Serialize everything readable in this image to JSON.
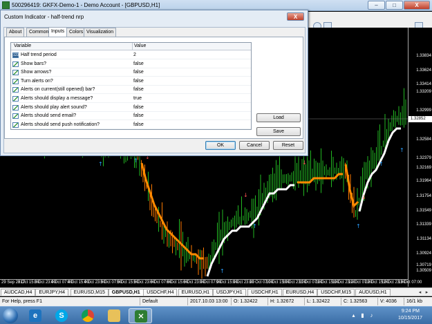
{
  "window": {
    "title": "500296419: GKFX-Demo-1 - Demo Account - [GBPUSD,H1]",
    "minimize": "–",
    "maximize": "□",
    "close": "X"
  },
  "dialog": {
    "title": "Custom Indicator - half-trend nrp",
    "close_label": "X",
    "tabs": [
      {
        "label": "About"
      },
      {
        "label": "Common"
      },
      {
        "label": "Inputs"
      },
      {
        "label": "Colors"
      },
      {
        "label": "Visualization"
      }
    ],
    "active_tab": "Inputs",
    "columns": {
      "variable": "Variable",
      "value": "Value"
    },
    "params": [
      {
        "name": "Half trend period",
        "value": "2",
        "kind": "param"
      },
      {
        "name": "Show bars?",
        "value": "false",
        "kind": "bool"
      },
      {
        "name": "Show arrows?",
        "value": "false",
        "kind": "bool"
      },
      {
        "name": "Turn alerts on?",
        "value": "false",
        "kind": "bool"
      },
      {
        "name": "Alerts on current(still opened) bar?",
        "value": "false",
        "kind": "bool"
      },
      {
        "name": "Alerts should display a message?",
        "value": "true",
        "kind": "bool"
      },
      {
        "name": "Alerts should play alert sound?",
        "value": "false",
        "kind": "bool"
      },
      {
        "name": "Alerts should send email?",
        "value": "false",
        "kind": "bool"
      },
      {
        "name": "Alerts should send push notification?",
        "value": "false",
        "kind": "bool"
      }
    ],
    "load_label": "Load",
    "save_label": "Save",
    "ok_label": "OK",
    "cancel_label": "Cancel",
    "reset_label": "Reset"
  },
  "chart": {
    "symbol": "GBPUSD,H1",
    "current_price": "1.32852",
    "price_labels": [
      "1.33834",
      "1.33624",
      "1.33414",
      "1.33209",
      "1.32999",
      "1.32584",
      "1.32379",
      "1.32169",
      "1.31964",
      "1.31754",
      "1.31549",
      "1.31339",
      "1.31134",
      "1.30924",
      "1.30719",
      "1.30509"
    ],
    "time_labels": [
      "29 Sep 2017",
      "3 Oct 15:00",
      "3 Oct 23:00",
      "4 Oct 07:00",
      "4 Oct 15:00",
      "4 Oct 23:00",
      "5 Oct 07:00",
      "5 Oct 15:00",
      "5 Oct 23:00",
      "6 Oct 07:00",
      "6 Oct 15:00",
      "6 Oct 23:00",
      "9 Oct 07:00",
      "9 Oct 15:00",
      "9 Oct 23:00",
      "10 Oct 07:00",
      "10 Oct 15:00",
      "10 Oct 23:00",
      "11 Oct 07:00",
      "11 Oct 15:00",
      "11 Oct 23:00",
      "12 Oct 07:00",
      "12 Oct 15:00",
      "12 Oct 23:00",
      "13 Oct 07:00"
    ]
  },
  "symbol_tabs": [
    "AUDCAD,H4",
    "EURJPY,H4",
    "EURUSD,M15",
    "GBPUSD,H1",
    "USDCHF,H4",
    "EURUSD,H1",
    "USDJPY,H1",
    "USDCHF,H1",
    "EURUSD,H4",
    "USDCHF,M15",
    "AUDUSD,H1"
  ],
  "status": {
    "help": "For Help, press F1",
    "profile": "Default",
    "datetime": "2017.10.03 13:00",
    "open": "O: 1.32422",
    "high": "H: 1.32672",
    "low": "L: 1.32422",
    "close": "C: 1.32563",
    "volume": "V: 4036",
    "traffic": "16/1 kb"
  },
  "taskbar": {
    "time": "9:24 PM",
    "date": "10/15/2017",
    "apps": [
      "ie",
      "skype",
      "chrome",
      "explorer",
      "metatrader"
    ]
  },
  "colors": {
    "bull_bars": "#22b822",
    "bear_bars": "#ff7a00",
    "halftrend_up": "#ffffff",
    "halftrend_down": "#ff8a00",
    "dots": "#ff2020",
    "arrows_up": "#2aa0ff",
    "arrows_down": "#ff5555"
  }
}
